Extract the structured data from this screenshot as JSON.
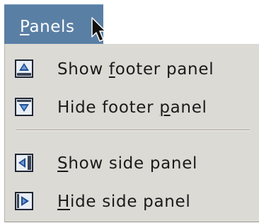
{
  "menubar": {
    "panels_prefix": "",
    "panels_mnemonic": "P",
    "panels_suffix": "anels"
  },
  "menu": {
    "items": [
      {
        "pre": "Show ",
        "mn": "f",
        "post": "ooter panel",
        "icon": "show-footer-panel-icon"
      },
      {
        "pre": "Hide footer ",
        "mn": "p",
        "post": "anel",
        "icon": "hide-footer-panel-icon"
      },
      {
        "pre": "",
        "mn": "S",
        "post": "how side panel",
        "icon": "show-side-panel-icon"
      },
      {
        "pre": "",
        "mn": "H",
        "post": "ide side panel",
        "icon": "hide-side-panel-icon"
      }
    ]
  },
  "colors": {
    "menubar_active": "#5a7fa4",
    "menu_background": "#dcdad5",
    "icon_frame": "#1e2633",
    "icon_arrow": "#1d4f91"
  }
}
